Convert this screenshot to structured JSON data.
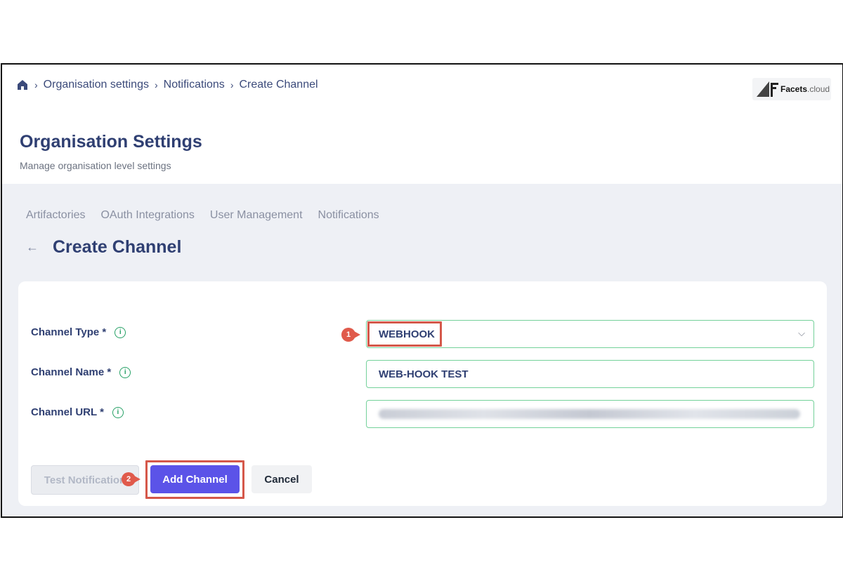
{
  "breadcrumb": {
    "items": [
      "Organisation settings",
      "Notifications",
      "Create Channel"
    ]
  },
  "logo": {
    "brand": "Facets",
    "tld": ".cloud"
  },
  "header": {
    "title": "Organisation Settings",
    "subtitle": "Manage organisation level settings"
  },
  "tabs": [
    "Artifactories",
    "OAuth Integrations",
    "User Management",
    "Notifications"
  ],
  "section": {
    "title": "Create Channel"
  },
  "form": {
    "channel_type": {
      "label": "Channel Type *",
      "value": "WEBHOOK"
    },
    "channel_name": {
      "label": "Channel Name *",
      "value": "WEB-HOOK TEST"
    },
    "channel_url": {
      "label": "Channel URL *"
    }
  },
  "buttons": {
    "test": "Test Notification",
    "add": "Add Channel",
    "cancel": "Cancel"
  },
  "callouts": [
    "1",
    "2"
  ],
  "colors": {
    "primary": "#5b53e8",
    "heading": "#2f3f72",
    "highlight": "#d5584a",
    "field_border": "#74d19a"
  },
  "icons": [
    "home-icon",
    "chevron-right-icon",
    "back-arrow-icon",
    "info-icon",
    "chevron-down-icon"
  ]
}
